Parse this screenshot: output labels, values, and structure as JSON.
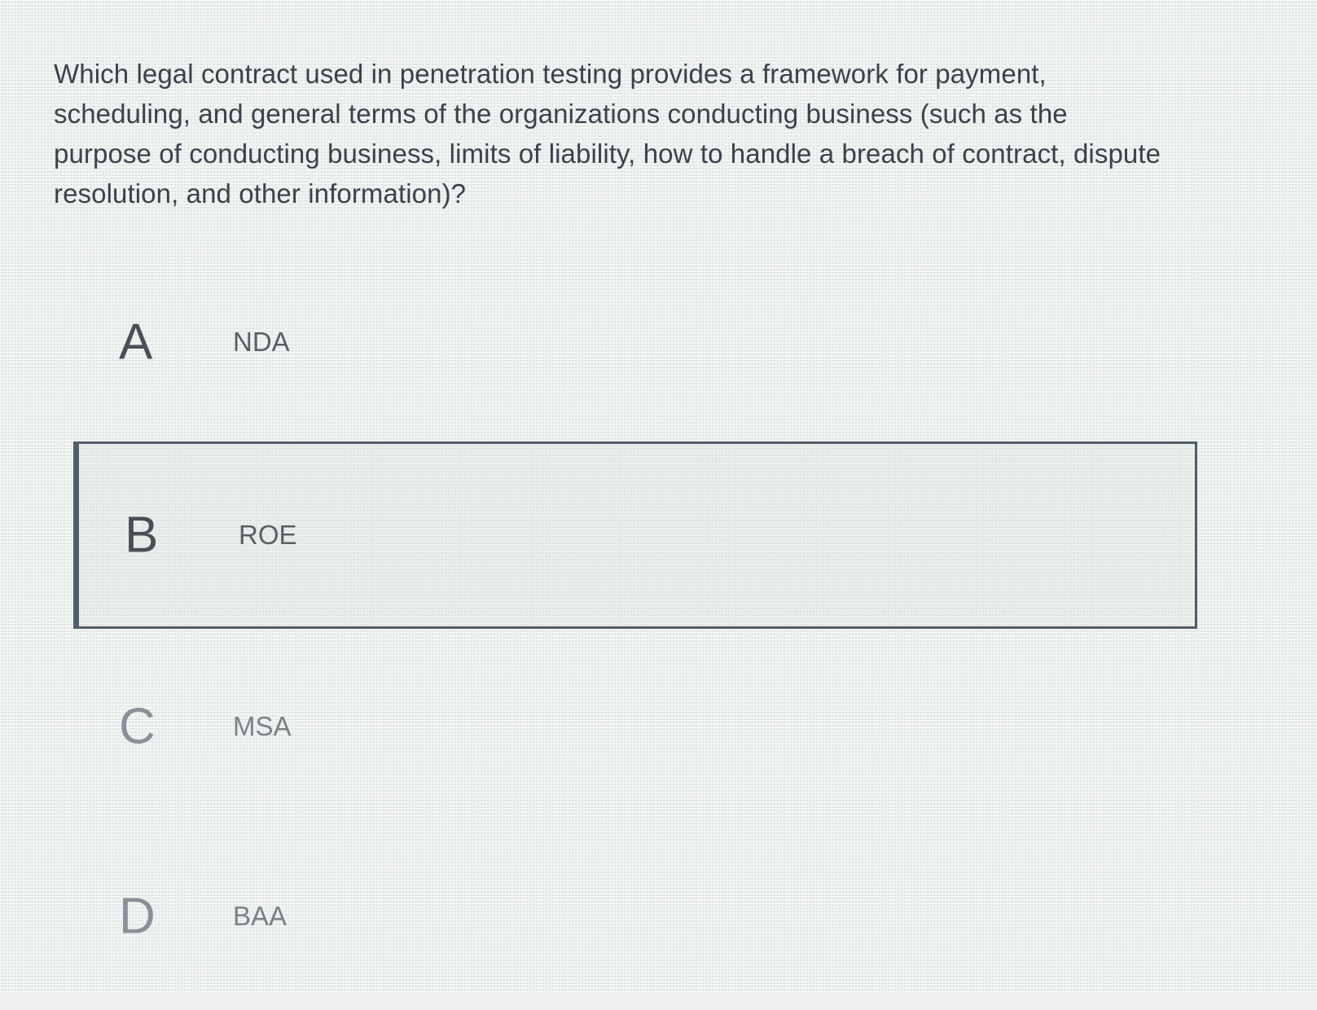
{
  "question": {
    "text": "Which legal contract used in penetration testing provides a framework for payment, scheduling, and general terms of the organizations conducting business (such as the purpose of conducting business, limits of liability, how to handle a breach of contract, dispute resolution, and other information)?"
  },
  "options": [
    {
      "letter": "A",
      "label": "NDA",
      "selected": false
    },
    {
      "letter": "B",
      "label": "ROE",
      "selected": true
    },
    {
      "letter": "C",
      "label": "MSA",
      "selected": false
    },
    {
      "letter": "D",
      "label": "BAA",
      "selected": false
    }
  ],
  "colors": {
    "selected_border": "#4f5d6c",
    "text": "#3c414b",
    "background": "#eef0ef"
  }
}
